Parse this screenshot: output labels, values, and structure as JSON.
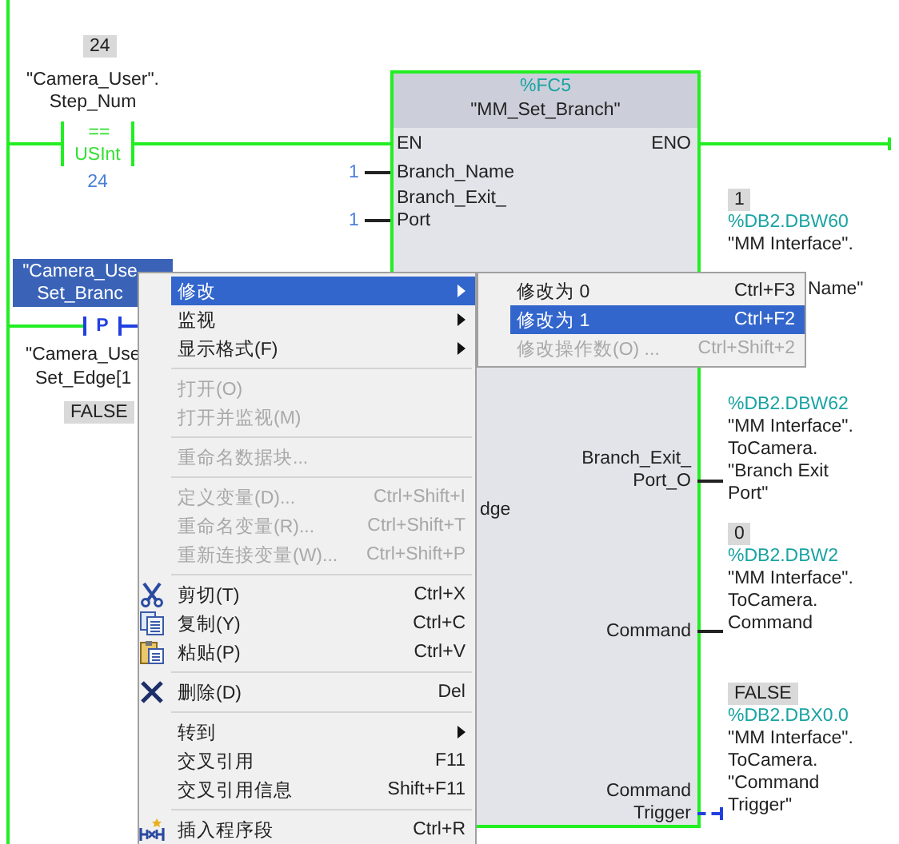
{
  "comparator": {
    "value": "24",
    "operand": [
      "\"Camera_User\".",
      "Step_Num"
    ],
    "symbol": "==",
    "type": "USInt",
    "compare_value": "24"
  },
  "edge_contact": {
    "operand_top": [
      "\"Camera_Use",
      "Set_Branc"
    ],
    "selected": true,
    "symbol": "P",
    "operand_bottom": [
      "\"Camera_Use",
      "Set_Edge[1"
    ],
    "value": "FALSE"
  },
  "block": {
    "address": "%FC5",
    "name": "\"MM_Set_Branch\"",
    "inputs": [
      {
        "label": [
          "EN"
        ]
      },
      {
        "label": [
          "Branch_Name"
        ],
        "constant": "1"
      },
      {
        "label": [
          "Branch_Exit_",
          "Port"
        ],
        "constant": "1"
      },
      {
        "label": [
          "dge"
        ]
      }
    ],
    "outputs": [
      {
        "label": [
          "ENO"
        ],
        "kind": "power"
      },
      {
        "label": [
          "Branch_Exit_",
          "Port_O"
        ],
        "kind": "solid"
      },
      {
        "label": [
          "Command"
        ],
        "kind": "solid"
      },
      {
        "label": [
          "Command",
          "Trigger"
        ],
        "kind": "dashed"
      }
    ]
  },
  "operands": [
    {
      "value": "1",
      "address": "%DB2.DBW60",
      "lines": [
        "\"MM Interface\"."
      ],
      "tail": "Name\""
    },
    {
      "address": "%DB2.DBW62",
      "lines": [
        "\"MM Interface\".",
        "ToCamera.",
        "\"Branch Exit",
        "Port\""
      ]
    },
    {
      "value": "0",
      "address": "%DB2.DBW2",
      "lines": [
        "\"MM Interface\".",
        "ToCamera.",
        "Command"
      ]
    },
    {
      "value": "FALSE",
      "address": "%DB2.DBX0.0",
      "lines": [
        "\"MM Interface\".",
        "ToCamera.",
        "\"Command",
        "Trigger\""
      ]
    }
  ],
  "context_menu": [
    {
      "kind": "plain",
      "label": "修改",
      "submenu": true,
      "selected": true,
      "disabled": false
    },
    {
      "kind": "plain",
      "label": "监视",
      "submenu": true,
      "selected": false,
      "disabled": false
    },
    {
      "kind": "plain",
      "label": "显示格式(F)",
      "submenu": true,
      "selected": false,
      "disabled": false
    },
    {
      "kind": "separator"
    },
    {
      "kind": "plain",
      "label": "打开(O)",
      "selected": false,
      "disabled": true
    },
    {
      "kind": "plain",
      "label": "打开并监视(M)",
      "selected": false,
      "disabled": true
    },
    {
      "kind": "separator"
    },
    {
      "kind": "plain",
      "label": "重命名数据块...",
      "selected": false,
      "disabled": true
    },
    {
      "kind": "separator"
    },
    {
      "kind": "plain",
      "label": "定义变量(D)...",
      "shortcut": "Ctrl+Shift+I",
      "selected": false,
      "disabled": true
    },
    {
      "kind": "plain",
      "label": "重命名变量(R)...",
      "shortcut": "Ctrl+Shift+T",
      "selected": false,
      "disabled": true
    },
    {
      "kind": "plain",
      "label": "重新连接变量(W)...",
      "shortcut": "Ctrl+Shift+P",
      "selected": false,
      "disabled": true
    },
    {
      "kind": "separator"
    },
    {
      "kind": "cut",
      "label": "剪切(T)",
      "shortcut": "Ctrl+X",
      "selected": false,
      "disabled": false
    },
    {
      "kind": "copy",
      "label": "复制(Y)",
      "shortcut": "Ctrl+C",
      "selected": false,
      "disabled": false
    },
    {
      "kind": "paste",
      "label": "粘贴(P)",
      "shortcut": "Ctrl+V",
      "selected": false,
      "disabled": false
    },
    {
      "kind": "separator"
    },
    {
      "kind": "delete",
      "label": "删除(D)",
      "shortcut": "Del",
      "selected": false,
      "disabled": false
    },
    {
      "kind": "separator"
    },
    {
      "kind": "plain",
      "label": "转到",
      "submenu": true,
      "selected": false,
      "disabled": false
    },
    {
      "kind": "plain",
      "label": "交叉引用",
      "shortcut": "F11",
      "selected": false,
      "disabled": false
    },
    {
      "kind": "plain",
      "label": "交叉引用信息",
      "shortcut": "Shift+F11",
      "selected": false,
      "disabled": false
    },
    {
      "kind": "separator"
    },
    {
      "kind": "insert",
      "label": "插入程序段",
      "shortcut": "Ctrl+R",
      "selected": false,
      "disabled": false
    }
  ],
  "submenu": [
    {
      "label": "修改为 0",
      "shortcut": "Ctrl+F3",
      "selected": false,
      "disabled": false
    },
    {
      "label": "修改为 1",
      "shortcut": "Ctrl+F2",
      "selected": true,
      "disabled": false
    },
    {
      "label": "修改操作数(O) ...",
      "shortcut": "Ctrl+Shift+2",
      "selected": false,
      "disabled": true
    }
  ]
}
